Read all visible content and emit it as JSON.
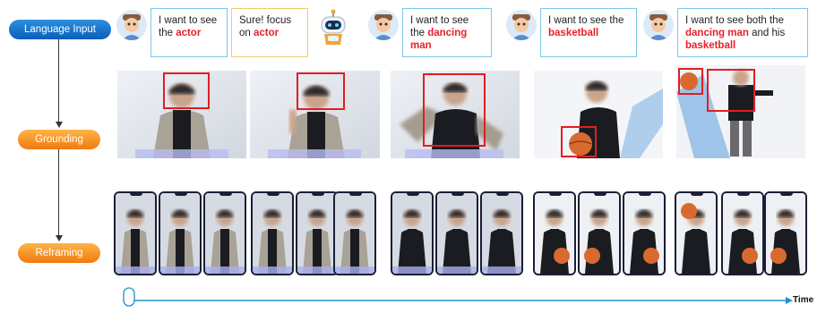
{
  "stages": {
    "language_input": "Language Input",
    "grounding": "Grounding",
    "reframing": "Reframing"
  },
  "timeline": {
    "label": "Time"
  },
  "colors": {
    "highlight": "#e8202a",
    "bbox": "#e21d23",
    "timeline": "#1e8fd6",
    "stage_blue": "#0a5fb8",
    "stage_orange": "#f07a10"
  },
  "bubbles": [
    {
      "prefix": "I want to see the ",
      "highlight": "actor",
      "suffix": ""
    },
    {
      "prefix": "Sure! focus on ",
      "highlight": "actor",
      "suffix": ""
    },
    {
      "prefix": "I want to see the ",
      "highlight": "dancing man",
      "suffix": ""
    },
    {
      "prefix": "I want to see the ",
      "highlight": "basketball",
      "suffix": ""
    },
    {
      "prefix": "I want to see both the ",
      "highlight": "dancing man",
      "suffix": " and his ",
      "highlight2": "basketball"
    }
  ]
}
